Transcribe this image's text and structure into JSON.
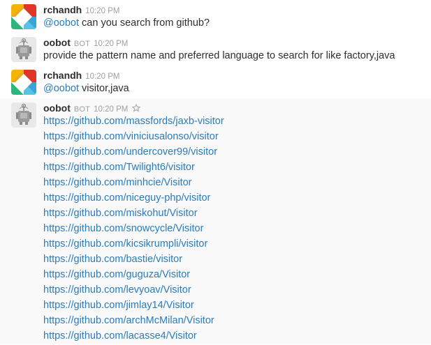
{
  "messages": [
    {
      "user": "rchandh",
      "time": "10:20 PM",
      "mention": "@oobot",
      "text": " can you search from github?"
    },
    {
      "user": "oobot",
      "badge": "BOT",
      "time": "10:20 PM",
      "text": "provide the pattern name and preferred language to search for like factory,java"
    },
    {
      "user": "rchandh",
      "time": "10:20 PM",
      "mention": "@oobot",
      "text": " visitor,java"
    },
    {
      "user": "oobot",
      "badge": "BOT",
      "time": "10:20 PM",
      "links": [
        "https://github.com/massfords/jaxb-visitor",
        "https://github.com/viniciusalonso/visitor",
        "https://github.com/undercover99/visitor",
        "https://github.com/Twilight6/visitor",
        "https://github.com/minhcie/Visitor",
        "https://github.com/niceguy-php/visitor",
        "https://github.com/miskohut/Visitor",
        "https://github.com/snowcycle/Visitor",
        "https://github.com/kicsikrumpli/visitor",
        "https://github.com/bastie/visitor",
        "https://github.com/guguza/Visitor",
        "https://github.com/levyoav/Visitor",
        "https://github.com/jimlay14/Visitor",
        "https://github.com/archMcMilan/Visitor",
        "https://github.com/lacasse4/Visitor"
      ]
    }
  ],
  "colors": {
    "link": "#2b7bb9",
    "hover_bg": "#f9f9f9",
    "meta": "#9e9ea6",
    "text": "#2c2d30"
  },
  "icons": {
    "rchandh_avatar": "colorful-x-logo-icon",
    "oobot_avatar": "robot-icon",
    "star": "star-outline-icon"
  }
}
